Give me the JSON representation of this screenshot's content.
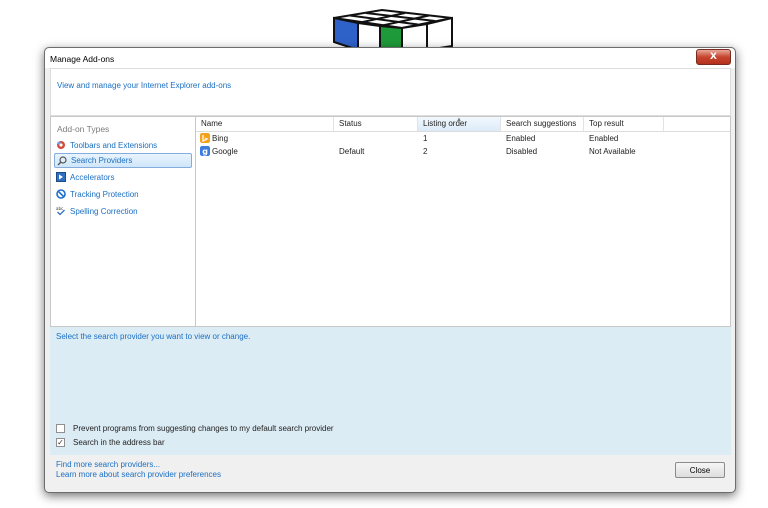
{
  "window": {
    "title": "Manage Add-ons",
    "close_glyph": "X"
  },
  "header": {
    "link": "View and manage your Internet Explorer add-ons"
  },
  "sidebar": {
    "heading": "Add-on Types",
    "items": [
      {
        "label": "Toolbars and Extensions",
        "icon": "gear-icon"
      },
      {
        "label": "Search Providers",
        "icon": "magnifier-icon",
        "selected": true
      },
      {
        "label": "Accelerators",
        "icon": "accelerator-icon"
      },
      {
        "label": "Tracking Protection",
        "icon": "no-entry-icon"
      },
      {
        "label": "Spelling Correction",
        "icon": "spelling-check-icon"
      }
    ]
  },
  "list": {
    "columns": [
      "Name",
      "Status",
      "Listing order",
      "Search suggestions",
      "Top result"
    ],
    "sorted_column": "Listing order",
    "rows": [
      {
        "name": "Bing",
        "status": "",
        "order": "1",
        "suggestions": "Enabled",
        "top_result": "Enabled",
        "icon": "bing-icon"
      },
      {
        "name": "Google",
        "status": "Default",
        "order": "2",
        "suggestions": "Disabled",
        "top_result": "Not Available",
        "icon": "google-icon"
      }
    ]
  },
  "details": {
    "text": "Select the search provider you want to view or change.",
    "checkboxes": [
      {
        "label": "Prevent programs from suggesting changes to my default search provider",
        "checked": false,
        "mark": ""
      },
      {
        "label": "Search in the address bar",
        "checked": true,
        "mark": "✓"
      }
    ]
  },
  "footer": {
    "link1": "Find more search providers...",
    "link2": "Learn more about search provider preferences",
    "close_label": "Close"
  },
  "colors": {
    "link": "#1b6fc2",
    "details_bg": "#dcecf5",
    "close_red": "#c7452f"
  }
}
